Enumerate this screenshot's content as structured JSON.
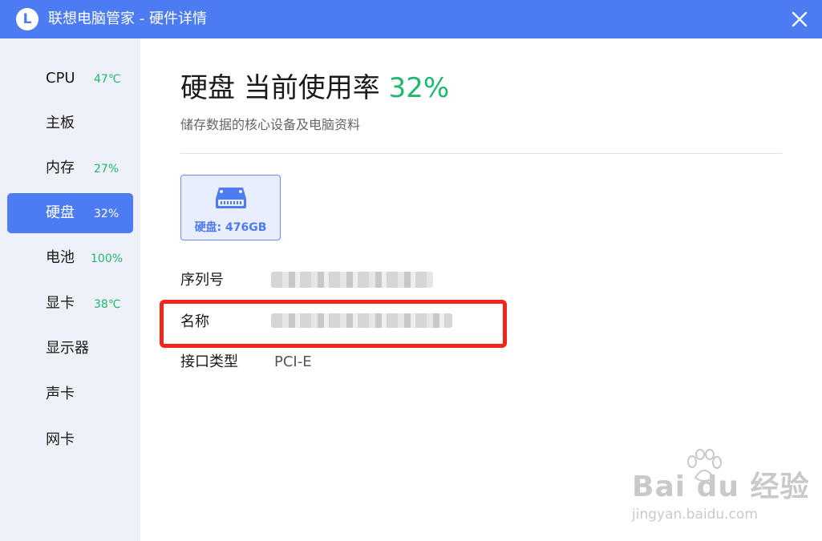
{
  "window": {
    "logo_letter": "L",
    "title": "联想电脑管家 - 硬件详情"
  },
  "sidebar": {
    "items": [
      {
        "label": "CPU",
        "value": "47℃",
        "active": false
      },
      {
        "label": "主板",
        "value": "",
        "active": false
      },
      {
        "label": "内存",
        "value": "27%",
        "active": false
      },
      {
        "label": "硬盘",
        "value": "32%",
        "active": true
      },
      {
        "label": "电池",
        "value": "100%",
        "active": false
      },
      {
        "label": "显卡",
        "value": "38℃",
        "active": false
      },
      {
        "label": "显示器",
        "value": "",
        "active": false
      },
      {
        "label": "声卡",
        "value": "",
        "active": false
      },
      {
        "label": "网卡",
        "value": "",
        "active": false
      }
    ]
  },
  "main": {
    "title": "硬盘 当前使用率",
    "usage": "32%",
    "subtitle": "储存数据的核心设备及电脑资料",
    "disk_card": {
      "label": "硬盘: 476GB"
    },
    "info": [
      {
        "label": "序列号",
        "value": ""
      },
      {
        "label": "名称",
        "value": ""
      },
      {
        "label": "接口类型",
        "value": "PCI-E"
      }
    ]
  },
  "watermark": {
    "main": "Bai du 经验",
    "sub": "jingyan.baidu.com"
  },
  "colors": {
    "accent": "#4d7cf2",
    "green": "#1fb86e",
    "highlight": "#f0261b",
    "sidebar_bg": "#eef1f8"
  }
}
